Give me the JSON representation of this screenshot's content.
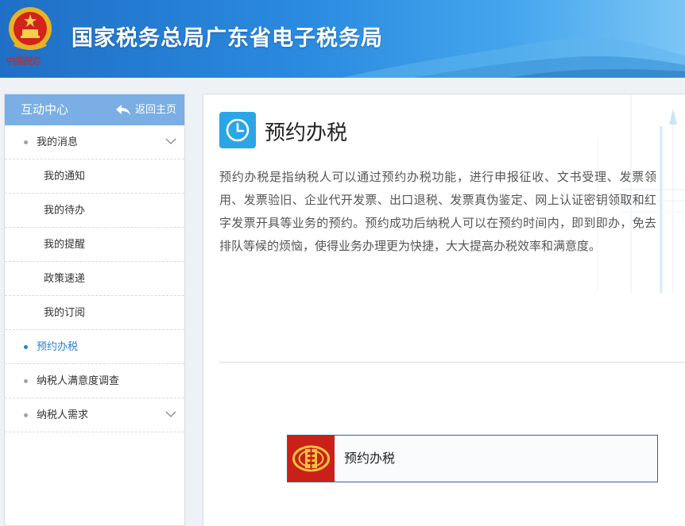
{
  "header": {
    "site_title": "国家税务总局广东省电子税务局",
    "motto": "中国税务"
  },
  "sidebar": {
    "title": "互动中心",
    "back_label": "返回主页",
    "items": [
      {
        "label": "我的消息",
        "level": "top",
        "expandable": true,
        "active": false
      },
      {
        "label": "我的通知",
        "level": "sub",
        "active": false
      },
      {
        "label": "我的待办",
        "level": "sub",
        "active": false
      },
      {
        "label": "我的提醒",
        "level": "sub",
        "active": false
      },
      {
        "label": "政策速递",
        "level": "sub",
        "active": false
      },
      {
        "label": "我的订阅",
        "level": "sub",
        "active": false
      },
      {
        "label": "预约办税",
        "level": "top",
        "expandable": false,
        "active": true
      },
      {
        "label": "纳税人满意度调查",
        "level": "top",
        "expandable": false,
        "active": false
      },
      {
        "label": "纳税人需求",
        "level": "top",
        "expandable": true,
        "active": false
      }
    ]
  },
  "main": {
    "icon": "clock-icon",
    "title": "预约办税",
    "description": "预约办税是指纳税人可以通过预约办税功能，进行申报征收、文书受理、发票领用、发票验旧、企业代开发票、出口退税、发票真伪鉴定、网上认证密钥领取和红字发票开具等业务的预约。预约成功后纳税人可以在预约时间内，即到即办，免去排队等候的烦恼，使得业务办理更为快捷，大大提高办税效率和满意度。",
    "entry_label": "预约办税"
  },
  "colors": {
    "header_blue": "#2a8be0",
    "sidebar_head": "#7aaee4",
    "active_text": "#2a7fd0",
    "clock_tile": "#2aa5e6",
    "entry_border": "#2a62a8",
    "tax_logo_red": "#c9201a"
  }
}
